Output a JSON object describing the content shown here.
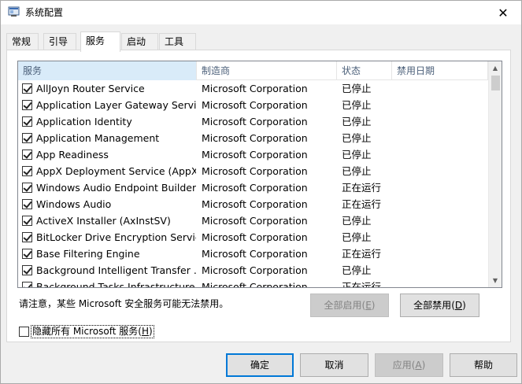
{
  "window": {
    "title": "系统配置",
    "close_glyph": "✕"
  },
  "tabs": [
    {
      "label": "常规"
    },
    {
      "label": "引导"
    },
    {
      "label": "服务"
    },
    {
      "label": "启动"
    },
    {
      "label": "工具"
    }
  ],
  "active_tab": "服务",
  "columns": [
    "服务",
    "制造商",
    "状态",
    "禁用日期"
  ],
  "services": [
    {
      "name": "AllJoyn Router Service",
      "manufacturer": "Microsoft Corporation",
      "status": "已停止",
      "disabled_date": "",
      "checked": true
    },
    {
      "name": "Application Layer Gateway Service",
      "manufacturer": "Microsoft Corporation",
      "status": "已停止",
      "disabled_date": "",
      "checked": true
    },
    {
      "name": "Application Identity",
      "manufacturer": "Microsoft Corporation",
      "status": "已停止",
      "disabled_date": "",
      "checked": true
    },
    {
      "name": "Application Management",
      "manufacturer": "Microsoft Corporation",
      "status": "已停止",
      "disabled_date": "",
      "checked": true
    },
    {
      "name": "App Readiness",
      "manufacturer": "Microsoft Corporation",
      "status": "已停止",
      "disabled_date": "",
      "checked": true
    },
    {
      "name": "AppX Deployment Service (AppX...",
      "manufacturer": "Microsoft Corporation",
      "status": "已停止",
      "disabled_date": "",
      "checked": true
    },
    {
      "name": "Windows Audio Endpoint Builder",
      "manufacturer": "Microsoft Corporation",
      "status": "正在运行",
      "disabled_date": "",
      "checked": true
    },
    {
      "name": "Windows Audio",
      "manufacturer": "Microsoft Corporation",
      "status": "正在运行",
      "disabled_date": "",
      "checked": true
    },
    {
      "name": "ActiveX Installer (AxInstSV)",
      "manufacturer": "Microsoft Corporation",
      "status": "已停止",
      "disabled_date": "",
      "checked": true
    },
    {
      "name": "BitLocker Drive Encryption Service",
      "manufacturer": "Microsoft Corporation",
      "status": "已停止",
      "disabled_date": "",
      "checked": true
    },
    {
      "name": "Base Filtering Engine",
      "manufacturer": "Microsoft Corporation",
      "status": "正在运行",
      "disabled_date": "",
      "checked": true
    },
    {
      "name": "Background Intelligent Transfer ...",
      "manufacturer": "Microsoft Corporation",
      "status": "已停止",
      "disabled_date": "",
      "checked": true
    },
    {
      "name": "Background Tasks Infrastructure...",
      "manufacturer": "Microsoft Corporation",
      "status": "正在运行",
      "disabled_date": "",
      "checked": true
    }
  ],
  "note": "请注意，某些 Microsoft 安全服务可能无法禁用。",
  "enable_all": {
    "label": "全部启用",
    "accel": "E",
    "enabled": false
  },
  "disable_all": {
    "label": "全部禁用",
    "accel": "D",
    "enabled": true
  },
  "hide_ms": {
    "label": "隐藏所有 Microsoft 服务",
    "accel": "H",
    "checked": false
  },
  "buttons": {
    "ok": "确定",
    "cancel": "取消",
    "apply": {
      "label": "应用",
      "accel": "A",
      "enabled": false
    },
    "help": "帮助"
  },
  "colors": {
    "accent": "#0078d7",
    "sorted_header": "#d9ebf9"
  },
  "icons": {
    "app": "msconfig-icon",
    "close": "close-icon",
    "scroll_up": "chevron-up-icon",
    "scroll_down": "chevron-down-icon"
  }
}
